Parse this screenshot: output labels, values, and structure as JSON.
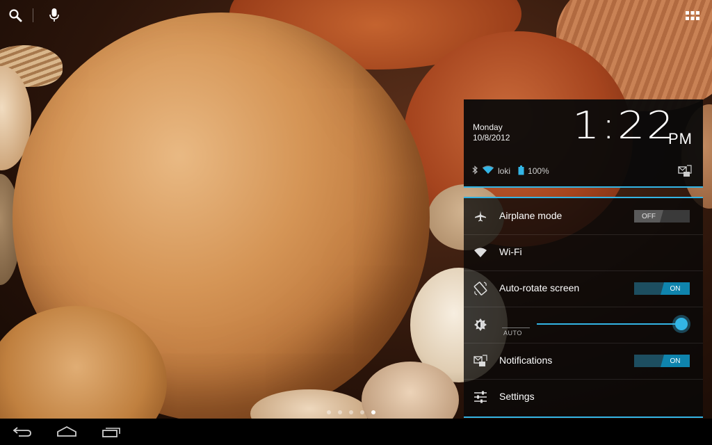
{
  "launcher": {
    "search_icon": "search-icon",
    "voice_icon": "mic-icon",
    "apps_icon": "all-apps-grid-icon",
    "page_count": 5,
    "active_page": 4
  },
  "clock": {
    "day": "Monday",
    "date": "10/8/2012",
    "time": "1:22",
    "ampm": "PM"
  },
  "status": {
    "network": "loki",
    "battery": "100%"
  },
  "quick_settings": {
    "airplane": {
      "label": "Airplane mode",
      "state": "OFF"
    },
    "wifi": {
      "label": "Wi-Fi"
    },
    "autorotate": {
      "label": "Auto-rotate screen",
      "state": "ON"
    },
    "brightness": {
      "auto_label": "AUTO",
      "level": 1.0
    },
    "notifications": {
      "label": "Notifications",
      "state": "ON"
    },
    "settings": {
      "label": "Settings"
    }
  },
  "colors": {
    "accent": "#33b5e5"
  }
}
